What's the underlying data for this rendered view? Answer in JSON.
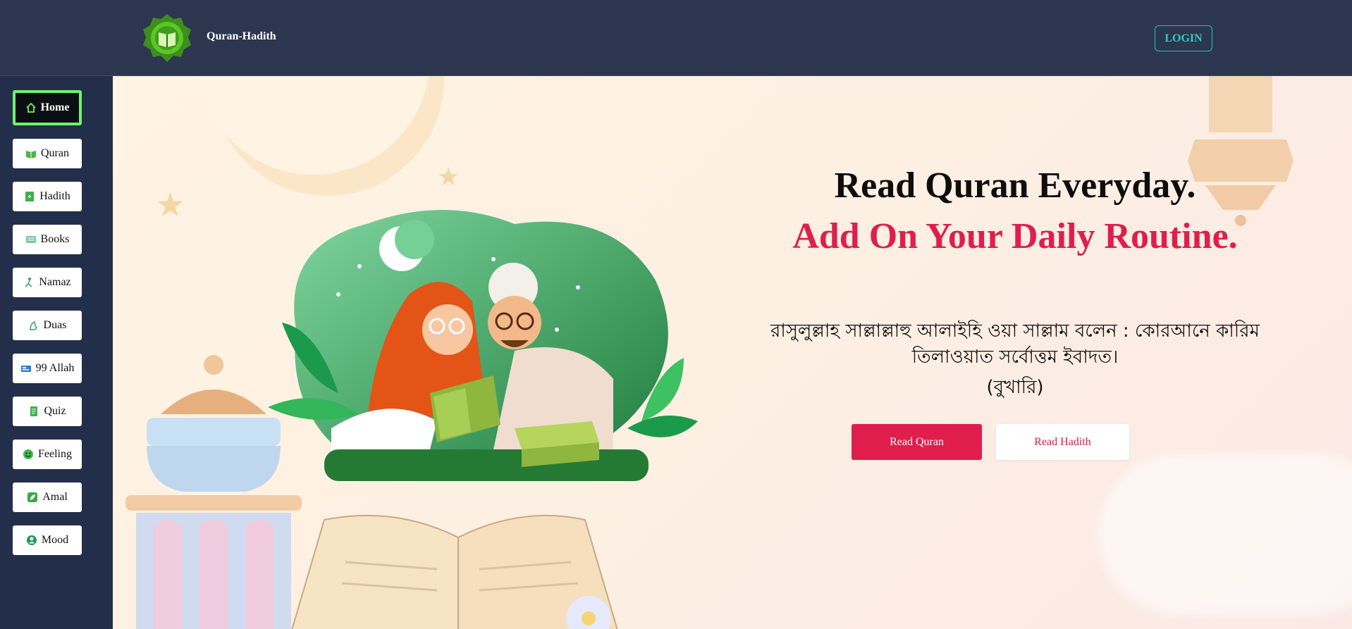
{
  "header": {
    "brand": "Quran-Hadith",
    "login_label": "LOGIN",
    "logo_icon": "quran-book-icon"
  },
  "sidebar": {
    "items": [
      {
        "label": "Home",
        "icon": "home-icon",
        "active": true
      },
      {
        "label": "Quran",
        "icon": "open-book-icon"
      },
      {
        "label": "Hadith",
        "icon": "hadith-book-icon"
      },
      {
        "label": "Books",
        "icon": "books-icon"
      },
      {
        "label": "Namaz",
        "icon": "prayer-icon"
      },
      {
        "label": "Duas",
        "icon": "dua-hands-icon"
      },
      {
        "label": "99 Allah",
        "icon": "names-card-icon"
      },
      {
        "label": "Quiz",
        "icon": "quiz-icon"
      },
      {
        "label": "Feeling",
        "icon": "smile-icon"
      },
      {
        "label": "Amal",
        "icon": "leaf-icon"
      },
      {
        "label": "Mood",
        "icon": "user-circle-icon"
      }
    ]
  },
  "hero": {
    "headline1": "Read Quran Everyday.",
    "headline2": "Add On Your Daily Routine.",
    "hadith_text": "রাসুলুল্লাহ সাল্লাল্লাহু আলাইহি ওয়া সাল্লাম বলেন : কোরআনে কারিম তিলাওয়াত সর্বোত্তম ইবাদত।",
    "hadith_source": "(বুখারি)",
    "read_quran_label": "Read Quran",
    "read_hadith_label": "Read Hadith"
  },
  "colors": {
    "accent": "#e01e4d",
    "nav_active_border": "#6ef56c",
    "login_border": "#2bbfb3",
    "header_bg": "#2c374f"
  }
}
